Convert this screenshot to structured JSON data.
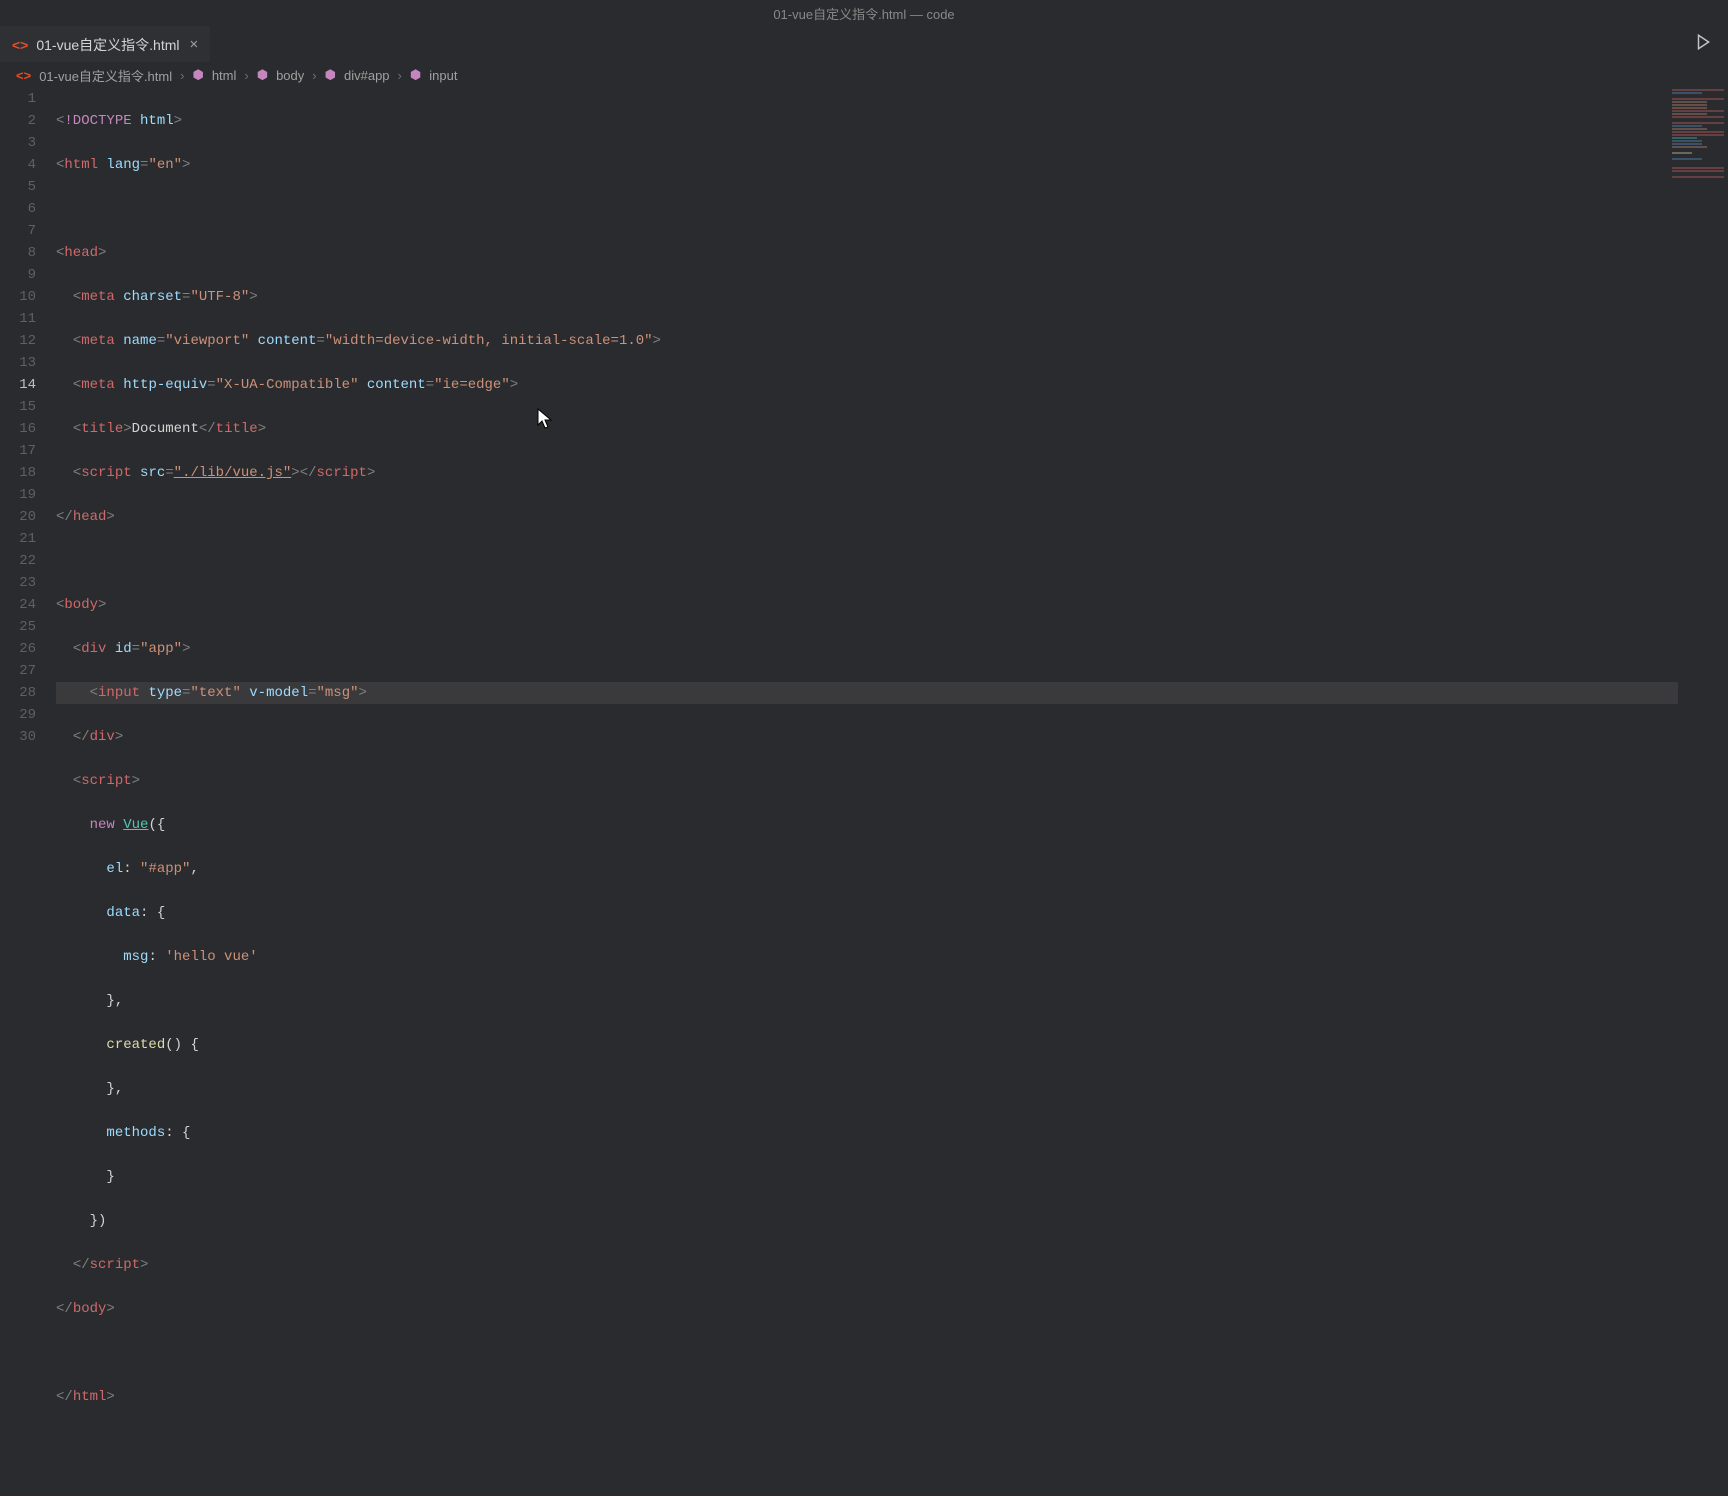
{
  "titleBar": "01-vue自定义指令.html — code",
  "tab": {
    "icon": "<>",
    "filename": "01-vue自定义指令.html",
    "close": "×"
  },
  "breadcrumb": {
    "icon": "<>",
    "file": "01-vue自定义指令.html",
    "sep": "›",
    "p1": "html",
    "p2": "body",
    "p3": "div#app",
    "p4": "input"
  },
  "lines": {
    "l1": "1",
    "l2": "2",
    "l3": "3",
    "l4": "4",
    "l5": "5",
    "l6": "6",
    "l7": "7",
    "l8": "8",
    "l9": "9",
    "l10": "10",
    "l11": "11",
    "l12": "12",
    "l13": "13",
    "l14": "14",
    "l15": "15",
    "l16": "16",
    "l17": "17",
    "l18": "18",
    "l19": "19",
    "l20": "20",
    "l21": "21",
    "l22": "22",
    "l23": "23",
    "l24": "24",
    "l25": "25",
    "l26": "26",
    "l27": "27",
    "l28": "28",
    "l29": "29",
    "l30": "30"
  },
  "code": {
    "doctype_kw": "!DOCTYPE",
    "doctype_arg": " html",
    "html": "html",
    "lang_attr": "lang",
    "lang_val": "\"en\"",
    "head": "head",
    "meta": "meta",
    "charset_attr": "charset",
    "charset_val": "\"UTF-8\"",
    "name_attr": "name",
    "viewport_val": "\"viewport\"",
    "content_attr": "content",
    "content_vp_val": "\"width=device-width, initial-scale=1.0\"",
    "httpequiv_attr": "http-equiv",
    "httpequiv_val": "\"X-UA-Compatible\"",
    "content_ie_val": "\"ie=edge\"",
    "title": "title",
    "title_text": "Document",
    "script": "script",
    "src_attr": "src",
    "src_val": "\"./lib/vue.js\"",
    "body": "body",
    "div": "div",
    "id_attr": "id",
    "id_val": "\"app\"",
    "input": "input",
    "type_attr": "type",
    "type_val": "\"text\"",
    "vmodel_attr": "v-model",
    "vmodel_val": "\"msg\"",
    "new_kw": "new",
    "vue_cls": "Vue",
    "paren_open": "({",
    "el_prop": "el",
    "el_val": "\"#app\"",
    "data_prop": "data",
    "brace_open": "{",
    "msg_prop": "msg",
    "msg_val": "'hello vue'",
    "brace_close_comma": "},",
    "created_fn": "created",
    "created_sig": "() {",
    "methods_prop": "methods",
    "methods_sig": ": {",
    "brace_close": "}",
    "paren_close": "})"
  }
}
